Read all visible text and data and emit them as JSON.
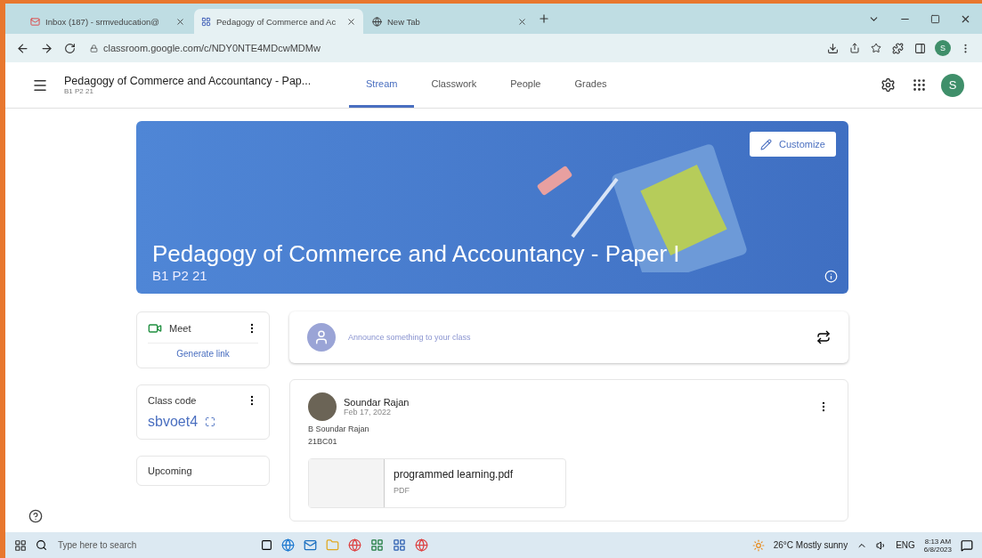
{
  "browser": {
    "tabs": [
      {
        "title": "Inbox (187) - srmveducation@",
        "selected": false,
        "kind": "mail"
      },
      {
        "title": "Pedagogy of Commerce and Ac",
        "selected": true,
        "kind": "classroom"
      },
      {
        "title": "New Tab",
        "selected": false,
        "kind": "chrome"
      }
    ],
    "url": "classroom.google.com/c/NDY0NTE4MDcwMDMw",
    "profile_initial": "S"
  },
  "header": {
    "class_title": "Pedagogy of Commerce and Accountancy - Pap...",
    "section": "B1 P2 21",
    "nav": [
      {
        "label": "Stream",
        "selected": true
      },
      {
        "label": "Classwork",
        "selected": false
      },
      {
        "label": "People",
        "selected": false
      },
      {
        "label": "Grades",
        "selected": false
      }
    ],
    "avatar_initial": "S"
  },
  "banner": {
    "customize": "Customize",
    "title": "Pedagogy of Commerce and Accountancy - Paper I",
    "section": "B1 P2 21"
  },
  "sidebar": {
    "meet_label": "Meet",
    "generate_link": "Generate link",
    "class_code_label": "Class code",
    "class_code": "sbvoet4",
    "upcoming": "Upcoming"
  },
  "announce": {
    "placeholder": "Announce something to your class"
  },
  "post": {
    "author": "Soundar Rajan",
    "date": "Feb 17, 2022",
    "lines": [
      "B Soundar Rajan",
      "21BC01"
    ],
    "attachment": {
      "name": "programmed learning.pdf",
      "type": "PDF"
    }
  },
  "taskbar": {
    "search_placeholder": "Type here to search",
    "weather": "26°C  Mostly sunny",
    "language": "ENG",
    "time": "8:13 AM",
    "date": "6/8/2023"
  }
}
